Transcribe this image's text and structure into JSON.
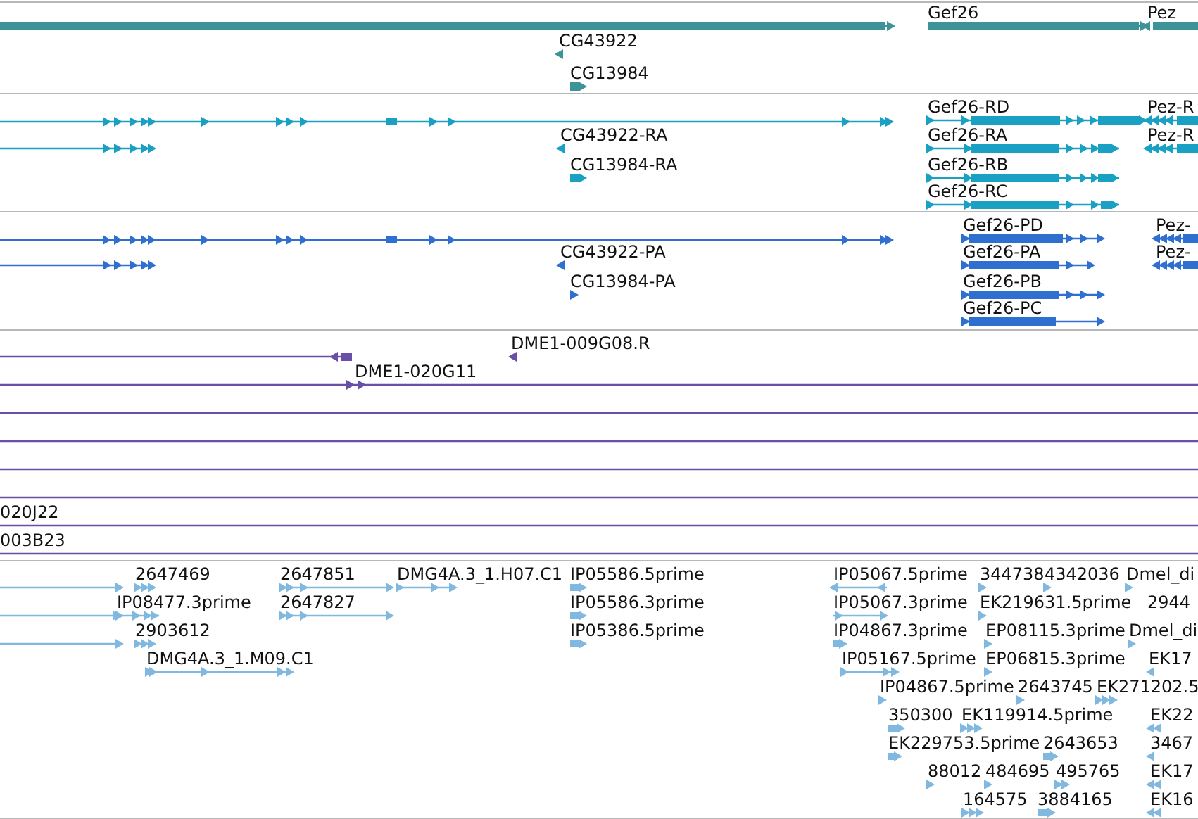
{
  "tracks": [
    {
      "color": "#3d9498",
      "features": [
        {
          "kind": "arrowed",
          "reverse": false
        },
        {
          "kind": "arrowed",
          "reverse": false,
          "label": "Gef26"
        },
        {
          "kind": "arrowed",
          "reverse": true,
          "label": "Pez"
        },
        {
          "kind": "arrowed",
          "reverse": true,
          "label": "CG43922"
        },
        {
          "kind": "arrowed",
          "reverse": false,
          "label": "CG13984"
        }
      ]
    },
    {
      "color": "#1aa0c2",
      "features": [
        {
          "kind": "arrowed",
          "reverse": false
        },
        {
          "kind": "arrowed",
          "reverse": false,
          "label": "Gef26-RD"
        },
        {
          "kind": "arrowed",
          "reverse": true,
          "label": "Pez-R"
        },
        {
          "kind": "arrowed",
          "reverse": false
        },
        {
          "kind": "arrowed",
          "reverse": true,
          "label": "CG43922-RA"
        },
        {
          "kind": "arrowed",
          "reverse": false,
          "label": "Gef26-RA"
        },
        {
          "kind": "arrowed",
          "reverse": true,
          "label": "Pez-R"
        },
        {
          "kind": "arrowed",
          "reverse": false,
          "label": "CG13984-RA"
        },
        {
          "kind": "arrowed",
          "reverse": false,
          "label": "Gef26-RB"
        },
        {
          "kind": "arrowed",
          "reverse": false,
          "label": "Gef26-RC"
        }
      ]
    },
    {
      "color": "#2f6fd0",
      "features": [
        {
          "kind": "arrowed",
          "reverse": false
        },
        {
          "kind": "arrowed",
          "reverse": false,
          "label": "Gef26-PD"
        },
        {
          "kind": "arrowed",
          "reverse": true,
          "label": "Pez-"
        },
        {
          "kind": "arrowed",
          "reverse": false
        },
        {
          "kind": "arrowed",
          "reverse": true,
          "label": "CG43922-PA"
        },
        {
          "kind": "arrowed",
          "reverse": false,
          "label": "Gef26-PA"
        },
        {
          "kind": "arrowed",
          "reverse": true,
          "label": "Pez-"
        },
        {
          "kind": "arrowed",
          "reverse": false,
          "label": "CG13984-PA"
        },
        {
          "kind": "arrowed",
          "reverse": false,
          "label": "Gef26-PB"
        },
        {
          "kind": "arrowed",
          "reverse": false,
          "label": "Gef26-PC"
        }
      ]
    },
    {
      "color": "#6a4fa8",
      "features": [
        {
          "kind": "arrowed",
          "reverse": true
        },
        {
          "kind": "arrowed",
          "reverse": true,
          "label": "DME1-009G08.R"
        },
        {
          "kind": "arrowed",
          "reverse": false,
          "label": "DME1-020G11"
        },
        {
          "kind": "plain"
        },
        {
          "kind": "plain"
        },
        {
          "kind": "plain"
        },
        {
          "kind": "plain"
        },
        {
          "kind": "plain",
          "label": "020J22"
        },
        {
          "kind": "plain",
          "label": "003B23"
        }
      ]
    },
    {
      "color": "#80b8e0",
      "features": [
        {
          "kind": "arrowed",
          "reverse": false
        },
        {
          "kind": "arrowed",
          "reverse": false,
          "label": "2647469"
        },
        {
          "kind": "arrowed",
          "reverse": false,
          "label": "2647851"
        },
        {
          "kind": "arrowed",
          "reverse": false,
          "label": "DMG4A.3_1.H07.C1"
        },
        {
          "kind": "arrowed",
          "reverse": false,
          "label": "IP05586.5prime"
        },
        {
          "kind": "arrowed",
          "reverse": true,
          "label": "IP05067.5prime"
        },
        {
          "kind": "arrowed",
          "reverse": false,
          "label": "344738"
        },
        {
          "kind": "arrowed",
          "reverse": false,
          "label": "4342036"
        },
        {
          "kind": "arrowed",
          "reverse": false,
          "label": "Dmel_di"
        },
        {
          "kind": "arrowed",
          "reverse": false
        },
        {
          "kind": "arrowed",
          "reverse": false,
          "label": "IP08477.3prime"
        },
        {
          "kind": "arrowed",
          "reverse": false,
          "label": "2647827"
        },
        {
          "kind": "arrowed",
          "reverse": false,
          "label": "IP05586.3prime"
        },
        {
          "kind": "arrowed",
          "reverse": false,
          "label": "IP05067.3prime"
        },
        {
          "kind": "arrowed",
          "reverse": false,
          "label": "EK219631.5prime"
        },
        {
          "kind": "arrowed",
          "label": "2944"
        },
        {
          "kind": "arrowed",
          "reverse": false
        },
        {
          "kind": "arrowed",
          "reverse": false,
          "label": "2903612"
        },
        {
          "kind": "arrowed",
          "reverse": false,
          "label": "IP05386.5prime"
        },
        {
          "kind": "arrowed",
          "reverse": false,
          "label": "IP04867.3prime"
        },
        {
          "kind": "arrowed",
          "reverse": false,
          "label": "EP08115.3prime"
        },
        {
          "kind": "arrowed",
          "reverse": false,
          "label": "Dmel_di"
        },
        {
          "kind": "arrowed",
          "reverse": false,
          "label": "DMG4A.3_1.M09.C1"
        },
        {
          "kind": "arrowed",
          "reverse": false,
          "label": "IP05167.5prime"
        },
        {
          "kind": "arrowed",
          "reverse": false,
          "label": "EP06815.3prime"
        },
        {
          "kind": "arrowed",
          "reverse": true,
          "label": "EK17"
        },
        {
          "kind": "arrowed",
          "reverse": false,
          "label": "IP04867.5prime"
        },
        {
          "kind": "arrowed",
          "reverse": false,
          "label": "2643745"
        },
        {
          "kind": "arrowed",
          "reverse": false,
          "label": "EK271202.5"
        },
        {
          "kind": "arrowed",
          "reverse": false,
          "label": "350300"
        },
        {
          "kind": "arrowed",
          "reverse": false,
          "label": "EK119914.5prime"
        },
        {
          "kind": "arrowed",
          "reverse": true,
          "label": "EK22"
        },
        {
          "kind": "arrowed",
          "reverse": false,
          "label": "EK229753.5prime"
        },
        {
          "kind": "arrowed",
          "reverse": false,
          "label": "2643653"
        },
        {
          "kind": "arrowed",
          "reverse": true,
          "label": "3467"
        },
        {
          "kind": "arrowed",
          "reverse": false,
          "label": "88012"
        },
        {
          "kind": "arrowed",
          "reverse": false,
          "label": "484695"
        },
        {
          "kind": "arrowed",
          "reverse": false,
          "label": "495765"
        },
        {
          "kind": "arrowed",
          "reverse": true,
          "label": "EK17"
        },
        {
          "kind": "arrowed",
          "reverse": false,
          "label": "164575"
        },
        {
          "kind": "arrowed",
          "reverse": false,
          "label": "3884165"
        },
        {
          "kind": "arrowed",
          "reverse": true,
          "label": "EK16"
        }
      ]
    }
  ]
}
